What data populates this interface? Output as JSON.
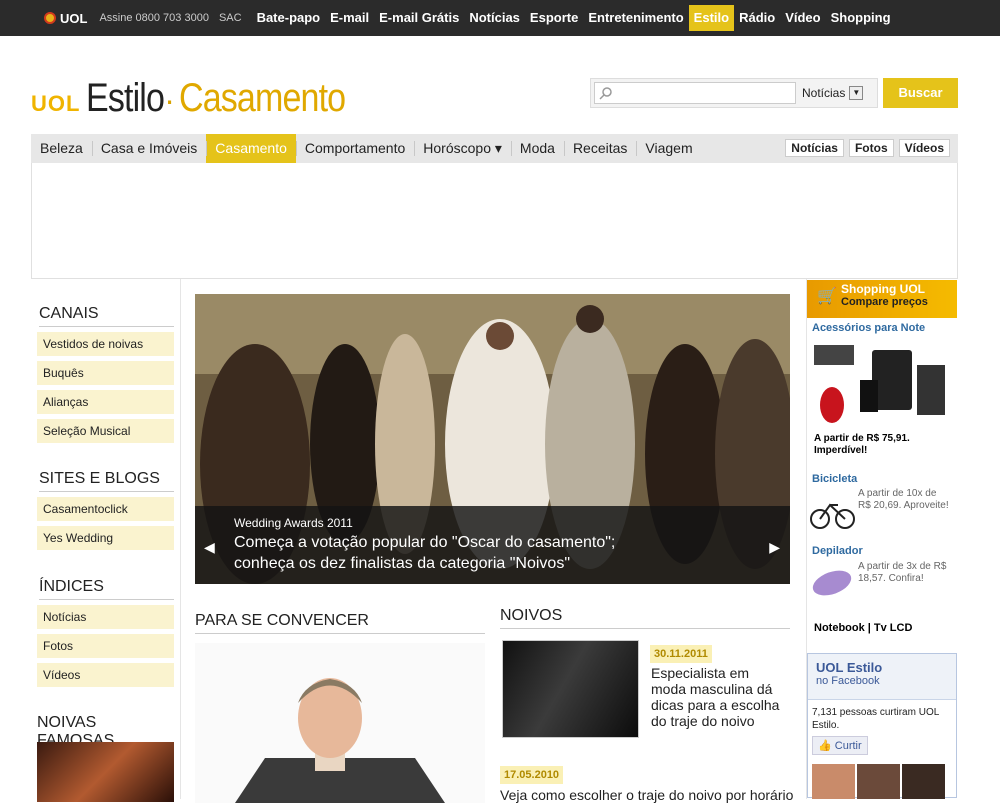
{
  "topbar": {
    "logo": "UOL",
    "assine": "Assine 0800 703 3000",
    "sac": "SAC",
    "links": [
      "Bate-papo",
      "E-mail",
      "E-mail Grátis",
      "Notícias",
      "Esporte",
      "Entretenimento",
      "Estilo",
      "Rádio",
      "Vídeo",
      "Shopping"
    ],
    "active": "Estilo"
  },
  "brand": {
    "uol": "UOL",
    "estilo": "Estilo",
    "sep": "·",
    "section": "Casamento"
  },
  "search": {
    "placeholder": "",
    "scope": "Notícias",
    "button": "Buscar"
  },
  "secnav": {
    "items": [
      "Beleza",
      "Casa e Imóveis",
      "Casamento",
      "Comportamento",
      "Horóscopo ▾",
      "Moda",
      "Receitas",
      "Viagem"
    ],
    "active": "Casamento",
    "right": [
      "Notícias",
      "Fotos",
      "Vídeos"
    ]
  },
  "left": {
    "canais_title": "CANAIS",
    "canais": [
      "Vestidos de noivas",
      "Buquês",
      "Alianças",
      "Seleção Musical"
    ],
    "sites_title": "SITES E BLOGS",
    "sites": [
      "Casamentoclick",
      "Yes Wedding"
    ],
    "indices_title": "ÍNDICES",
    "indices": [
      "Notícias",
      "Fotos",
      "Vídeos"
    ],
    "famosas_title": "NOIVAS FAMOSAS"
  },
  "hero": {
    "kicker": "Wedding Awards 2011",
    "headline": "Começa a votação popular do \"Oscar do casamento\"; conheça os dez finalistas da categoria \"Noivos\""
  },
  "convencer": {
    "title": "PARA SE CONVENCER"
  },
  "noivos": {
    "title": "NOIVOS",
    "items": [
      {
        "date": "30.11.2011",
        "text": "Especialista em moda masculina dá dicas para a escolha do traje do noivo"
      },
      {
        "date": "17.05.2010",
        "text": "Veja como escolher o traje do noivo por horário"
      }
    ]
  },
  "right": {
    "shop_title": "Shopping UOL",
    "shop_sub": "Compare preços",
    "acessorios": "Acessórios para Note",
    "acessorios_price": "A partir de R$ 75,91. Imperdível!",
    "bicicleta": "Bicicleta",
    "bicicleta_price": "A partir de 10x de R$ 20,69. Aproveite!",
    "depilador": "Depilador",
    "depilador_price": "A partir de 3x de R$ 18,57. Confira!",
    "notebook": "Notebook | Tv LCD",
    "fb_title": "UOL Estilo",
    "fb_sub": "no Facebook",
    "fb_count": "7,131 pessoas curtiram UOL Estilo.",
    "fb_like": "Curtir"
  }
}
